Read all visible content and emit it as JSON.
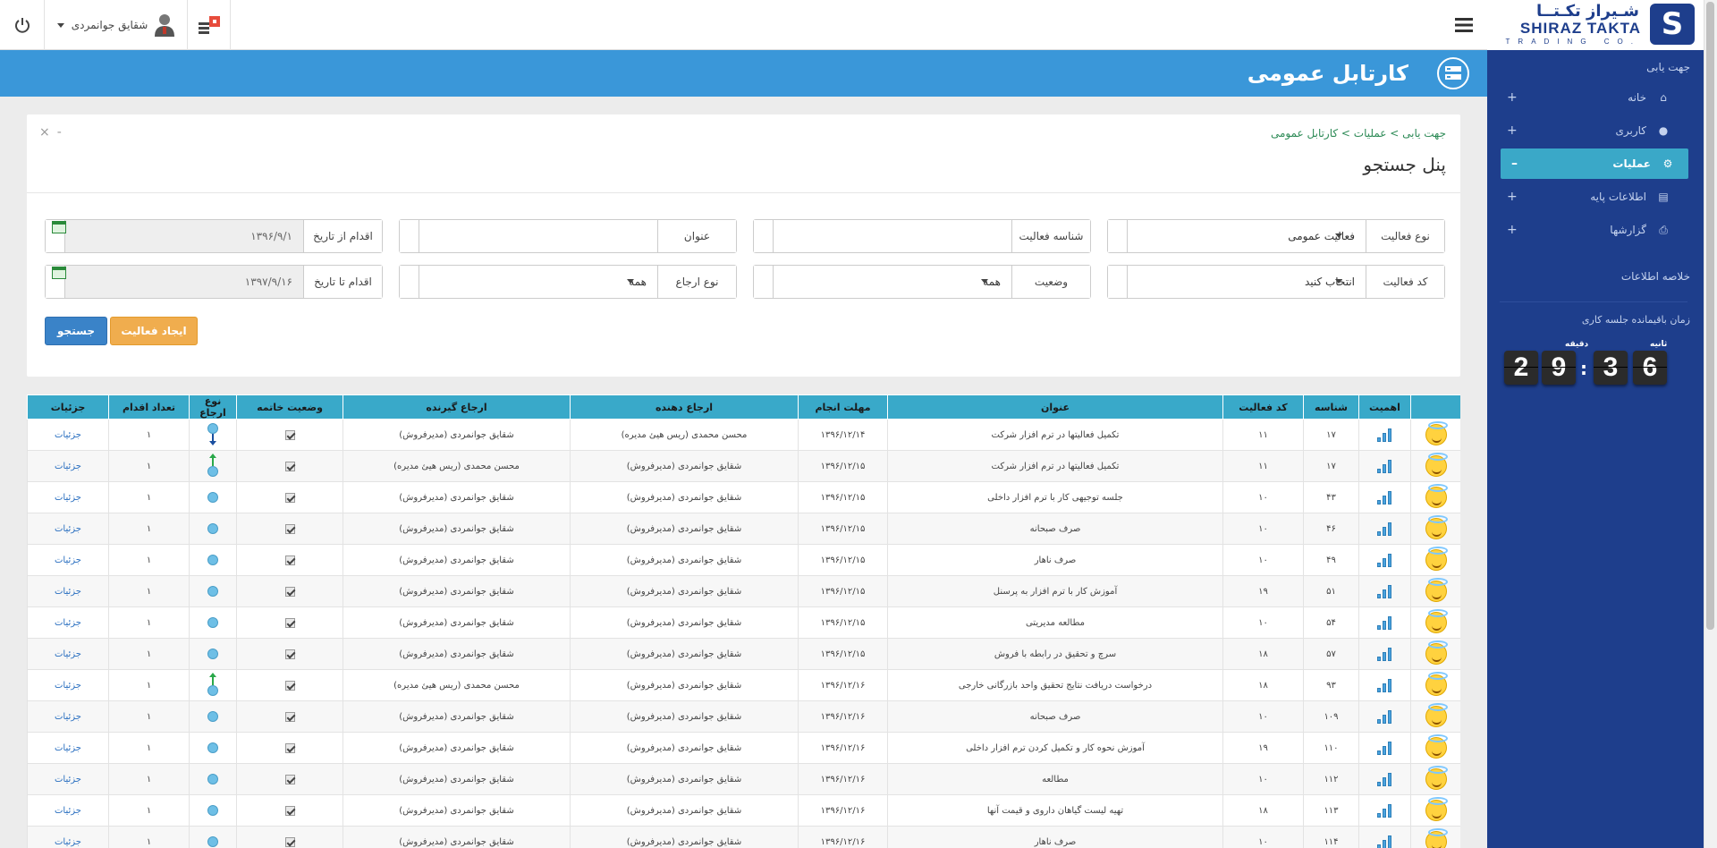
{
  "header": {
    "user_name": "شقایق جوانمردی",
    "page_title": "کارتابل عمومی"
  },
  "logo": {
    "fa": "شـیراز تکـتــا",
    "en": "SHIRAZ TAKTA",
    "sub": "TRADING CO."
  },
  "sidebar": {
    "heading": "جهت یابی",
    "items": [
      {
        "label": "خانه",
        "icon": "home-icon"
      },
      {
        "label": "کاربری",
        "icon": "user-icon"
      },
      {
        "label": "عملیات",
        "icon": "gears-icon"
      },
      {
        "label": "اطلاعات پایه",
        "icon": "book-icon"
      },
      {
        "label": "گزارشها",
        "icon": "printer-icon"
      }
    ],
    "summary": "خلاصه اطلاعات",
    "timer_label": "زمان باقیمانده جلسه کاری",
    "timer": {
      "minutes_label": "دقیقه",
      "seconds_label": "ثانیه",
      "m1": "2",
      "m2": "9",
      "s1": "3",
      "s2": "6"
    }
  },
  "panel": {
    "breadcrumb": "جهت یابی > عملیات > کارتابل عمومی",
    "title": "پنل جستجو",
    "fields": {
      "activity_type": {
        "label": "نوع فعالیت",
        "value": "فعالیت عمومی"
      },
      "activity_id": {
        "label": "شناسه فعالیت",
        "value": ""
      },
      "title": {
        "label": "عنوان",
        "value": ""
      },
      "from_date": {
        "label": "اقدام از تاریخ",
        "value": "۱۳۹۶/۹/۱"
      },
      "activity_code": {
        "label": "کد فعالیت",
        "value": "انتخاب کنید"
      },
      "status": {
        "label": "وضعیت",
        "value": "همه"
      },
      "referral_type": {
        "label": "نوع ارجاع",
        "value": "همه"
      },
      "to_date": {
        "label": "اقدام تا تاریخ",
        "value": "۱۳۹۷/۹/۱۶"
      }
    },
    "search_button": "جستجو",
    "create_button": "ایجاد فعالیت"
  },
  "table": {
    "columns": [
      "",
      "اهمیت",
      "شناسه",
      "کد فعالیت",
      "عنوان",
      "مهلت انجام",
      "ارجاع دهنده",
      "ارجاع گیرنده",
      "وضعیت خاتمه",
      "نوع ارجاع",
      "تعداد اقدام",
      "جزئیات"
    ],
    "details_label": "جزئیات",
    "rows": [
      {
        "id": "۱۷",
        "code": "۱۱",
        "title": "تکمیل فعالیتها در ترم افزار شرکت",
        "deadline": "۱۳۹۶/۱۲/۱۴",
        "from": "محسن محمدی (ریس هیئ مدیره)",
        "to": "شقایق جوانمردی (مدیرفروش)",
        "ref": "in",
        "count": "۱"
      },
      {
        "id": "۱۷",
        "code": "۱۱",
        "title": "تکمیل فعالیتها در ترم افزار شرکت",
        "deadline": "۱۳۹۶/۱۲/۱۵",
        "from": "شقایق جوانمردی (مدیرفروش)",
        "to": "محسن محمدی (ریس هیئ مدیره)",
        "ref": "out",
        "count": "۱"
      },
      {
        "id": "۴۳",
        "code": "۱۰",
        "title": "جلسه توجیهی کار با ترم افزار داخلی",
        "deadline": "۱۳۹۶/۱۲/۱۵",
        "from": "شقایق جوانمردی (مدیرفروش)",
        "to": "شقایق جوانمردی (مدیرفروش)",
        "ref": "self",
        "count": "۱"
      },
      {
        "id": "۴۶",
        "code": "۱۰",
        "title": "صرف صبحانه",
        "deadline": "۱۳۹۶/۱۲/۱۵",
        "from": "شقایق جوانمردی (مدیرفروش)",
        "to": "شقایق جوانمردی (مدیرفروش)",
        "ref": "self",
        "count": "۱"
      },
      {
        "id": "۴۹",
        "code": "۱۰",
        "title": "صرف ناهار",
        "deadline": "۱۳۹۶/۱۲/۱۵",
        "from": "شقایق جوانمردی (مدیرفروش)",
        "to": "شقایق جوانمردی (مدیرفروش)",
        "ref": "self",
        "count": "۱"
      },
      {
        "id": "۵۱",
        "code": "۱۹",
        "title": "آموزش کار با ترم افزار به پرسنل",
        "deadline": "۱۳۹۶/۱۲/۱۵",
        "from": "شقایق جوانمردی (مدیرفروش)",
        "to": "شقایق جوانمردی (مدیرفروش)",
        "ref": "self",
        "count": "۱"
      },
      {
        "id": "۵۴",
        "code": "۱۰",
        "title": "مطالعه مدیریتی",
        "deadline": "۱۳۹۶/۱۲/۱۵",
        "from": "شقایق جوانمردی (مدیرفروش)",
        "to": "شقایق جوانمردی (مدیرفروش)",
        "ref": "self",
        "count": "۱"
      },
      {
        "id": "۵۷",
        "code": "۱۸",
        "title": "سرچ و تحقیق در رابطه با فروش",
        "deadline": "۱۳۹۶/۱۲/۱۵",
        "from": "شقایق جوانمردی (مدیرفروش)",
        "to": "شقایق جوانمردی (مدیرفروش)",
        "ref": "self",
        "count": "۱"
      },
      {
        "id": "۹۳",
        "code": "۱۸",
        "title": "درخواست دریافت نتایج تحقیق واحد بازرگانی خارجی",
        "deadline": "۱۳۹۶/۱۲/۱۶",
        "from": "شقایق جوانمردی (مدیرفروش)",
        "to": "محسن محمدی (ریس هیئ مدیره)",
        "ref": "out",
        "count": "۱"
      },
      {
        "id": "۱۰۹",
        "code": "۱۰",
        "title": "صرف صبحانه",
        "deadline": "۱۳۹۶/۱۲/۱۶",
        "from": "شقایق جوانمردی (مدیرفروش)",
        "to": "شقایق جوانمردی (مدیرفروش)",
        "ref": "self",
        "count": "۱"
      },
      {
        "id": "۱۱۰",
        "code": "۱۹",
        "title": "آموزش نحوه کار و تکمیل کردن ترم افزار داخلی",
        "deadline": "۱۳۹۶/۱۲/۱۶",
        "from": "شقایق جوانمردی (مدیرفروش)",
        "to": "شقایق جوانمردی (مدیرفروش)",
        "ref": "self",
        "count": "۱"
      },
      {
        "id": "۱۱۲",
        "code": "۱۰",
        "title": "مطالعه",
        "deadline": "۱۳۹۶/۱۲/۱۶",
        "from": "شقایق جوانمردی (مدیرفروش)",
        "to": "شقایق جوانمردی (مدیرفروش)",
        "ref": "self",
        "count": "۱"
      },
      {
        "id": "۱۱۳",
        "code": "۱۸",
        "title": "تهیه لیست گیاهان داروی و قیمت آنها",
        "deadline": "۱۳۹۶/۱۲/۱۶",
        "from": "شقایق جوانمردی (مدیرفروش)",
        "to": "شقایق جوانمردی (مدیرفروش)",
        "ref": "self",
        "count": "۱"
      },
      {
        "id": "۱۱۴",
        "code": "۱۰",
        "title": "صرف ناهار",
        "deadline": "۱۳۹۶/۱۲/۱۶",
        "from": "شقایق جوانمردی (مدیرفروش)",
        "to": "شقایق جوانمردی (مدیرفروش)",
        "ref": "self",
        "count": "۱"
      }
    ]
  },
  "colors": {
    "accent": "#3a97d9",
    "sidebar": "#1e3e8c",
    "table_header": "#39a9c9",
    "active_item": "#3aa8c8"
  }
}
